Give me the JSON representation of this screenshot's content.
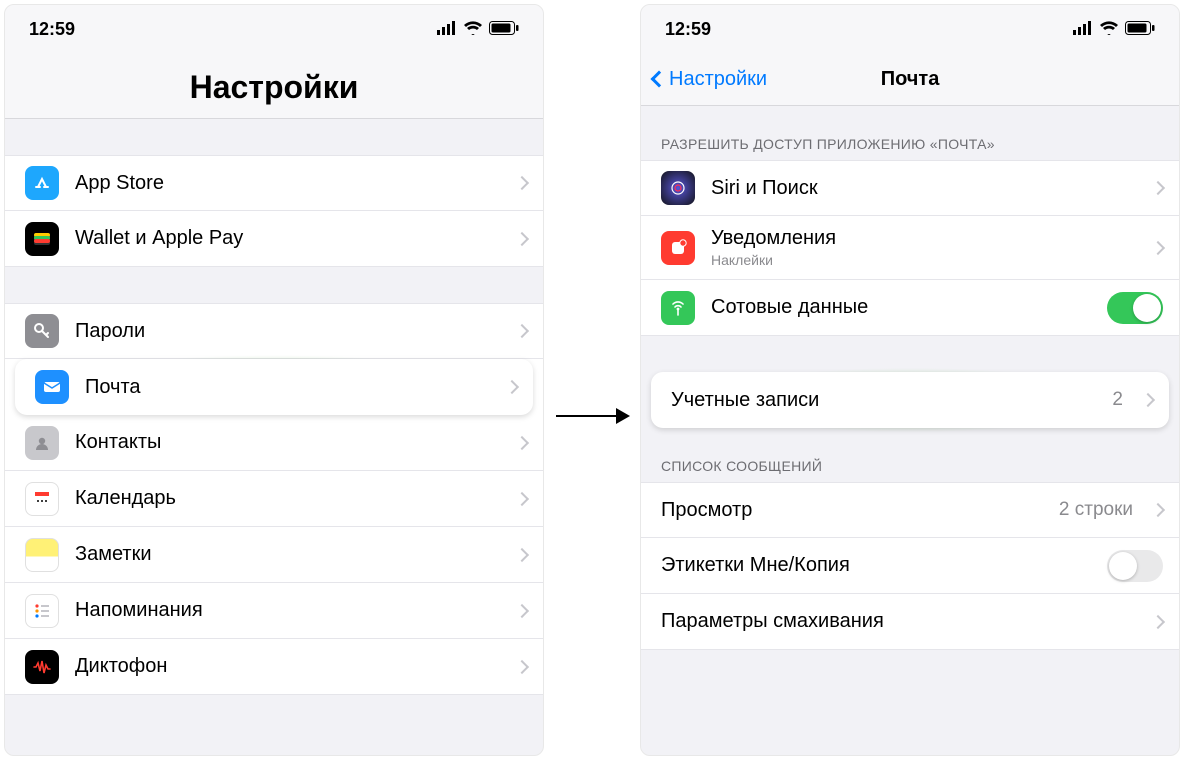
{
  "status": {
    "time": "12:59"
  },
  "left": {
    "title": "Настройки",
    "groups": {
      "g1": [
        {
          "label": "App Store",
          "icon": "appstore"
        },
        {
          "label": "Wallet и Apple Pay",
          "icon": "wallet"
        }
      ],
      "g2": [
        {
          "label": "Пароли",
          "icon": "passwords"
        },
        {
          "label": "Почта",
          "icon": "mail",
          "highlight": true
        },
        {
          "label": "Контакты",
          "icon": "contacts"
        },
        {
          "label": "Календарь",
          "icon": "calendar"
        },
        {
          "label": "Заметки",
          "icon": "notes"
        },
        {
          "label": "Напоминания",
          "icon": "reminders"
        },
        {
          "label": "Диктофон",
          "icon": "voice"
        }
      ]
    }
  },
  "right": {
    "back": "Настройки",
    "title": "Почта",
    "section1_header": "РАЗРЕШИТЬ ДОСТУП ПРИЛОЖЕНИЮ «ПОЧТА»",
    "siri": "Siri и Поиск",
    "notif": {
      "label": "Уведомления",
      "sub": "Наклейки"
    },
    "cell": {
      "label": "Сотовые данные",
      "on": true
    },
    "accounts": {
      "label": "Учетные записи",
      "count": "2"
    },
    "section2_header": "СПИСОК СООБЩЕНИЙ",
    "preview": {
      "label": "Просмотр",
      "value": "2 строки"
    },
    "cc": {
      "label": "Этикетки Мне/Копия",
      "on": false
    },
    "swipe": "Параметры смахивания"
  }
}
